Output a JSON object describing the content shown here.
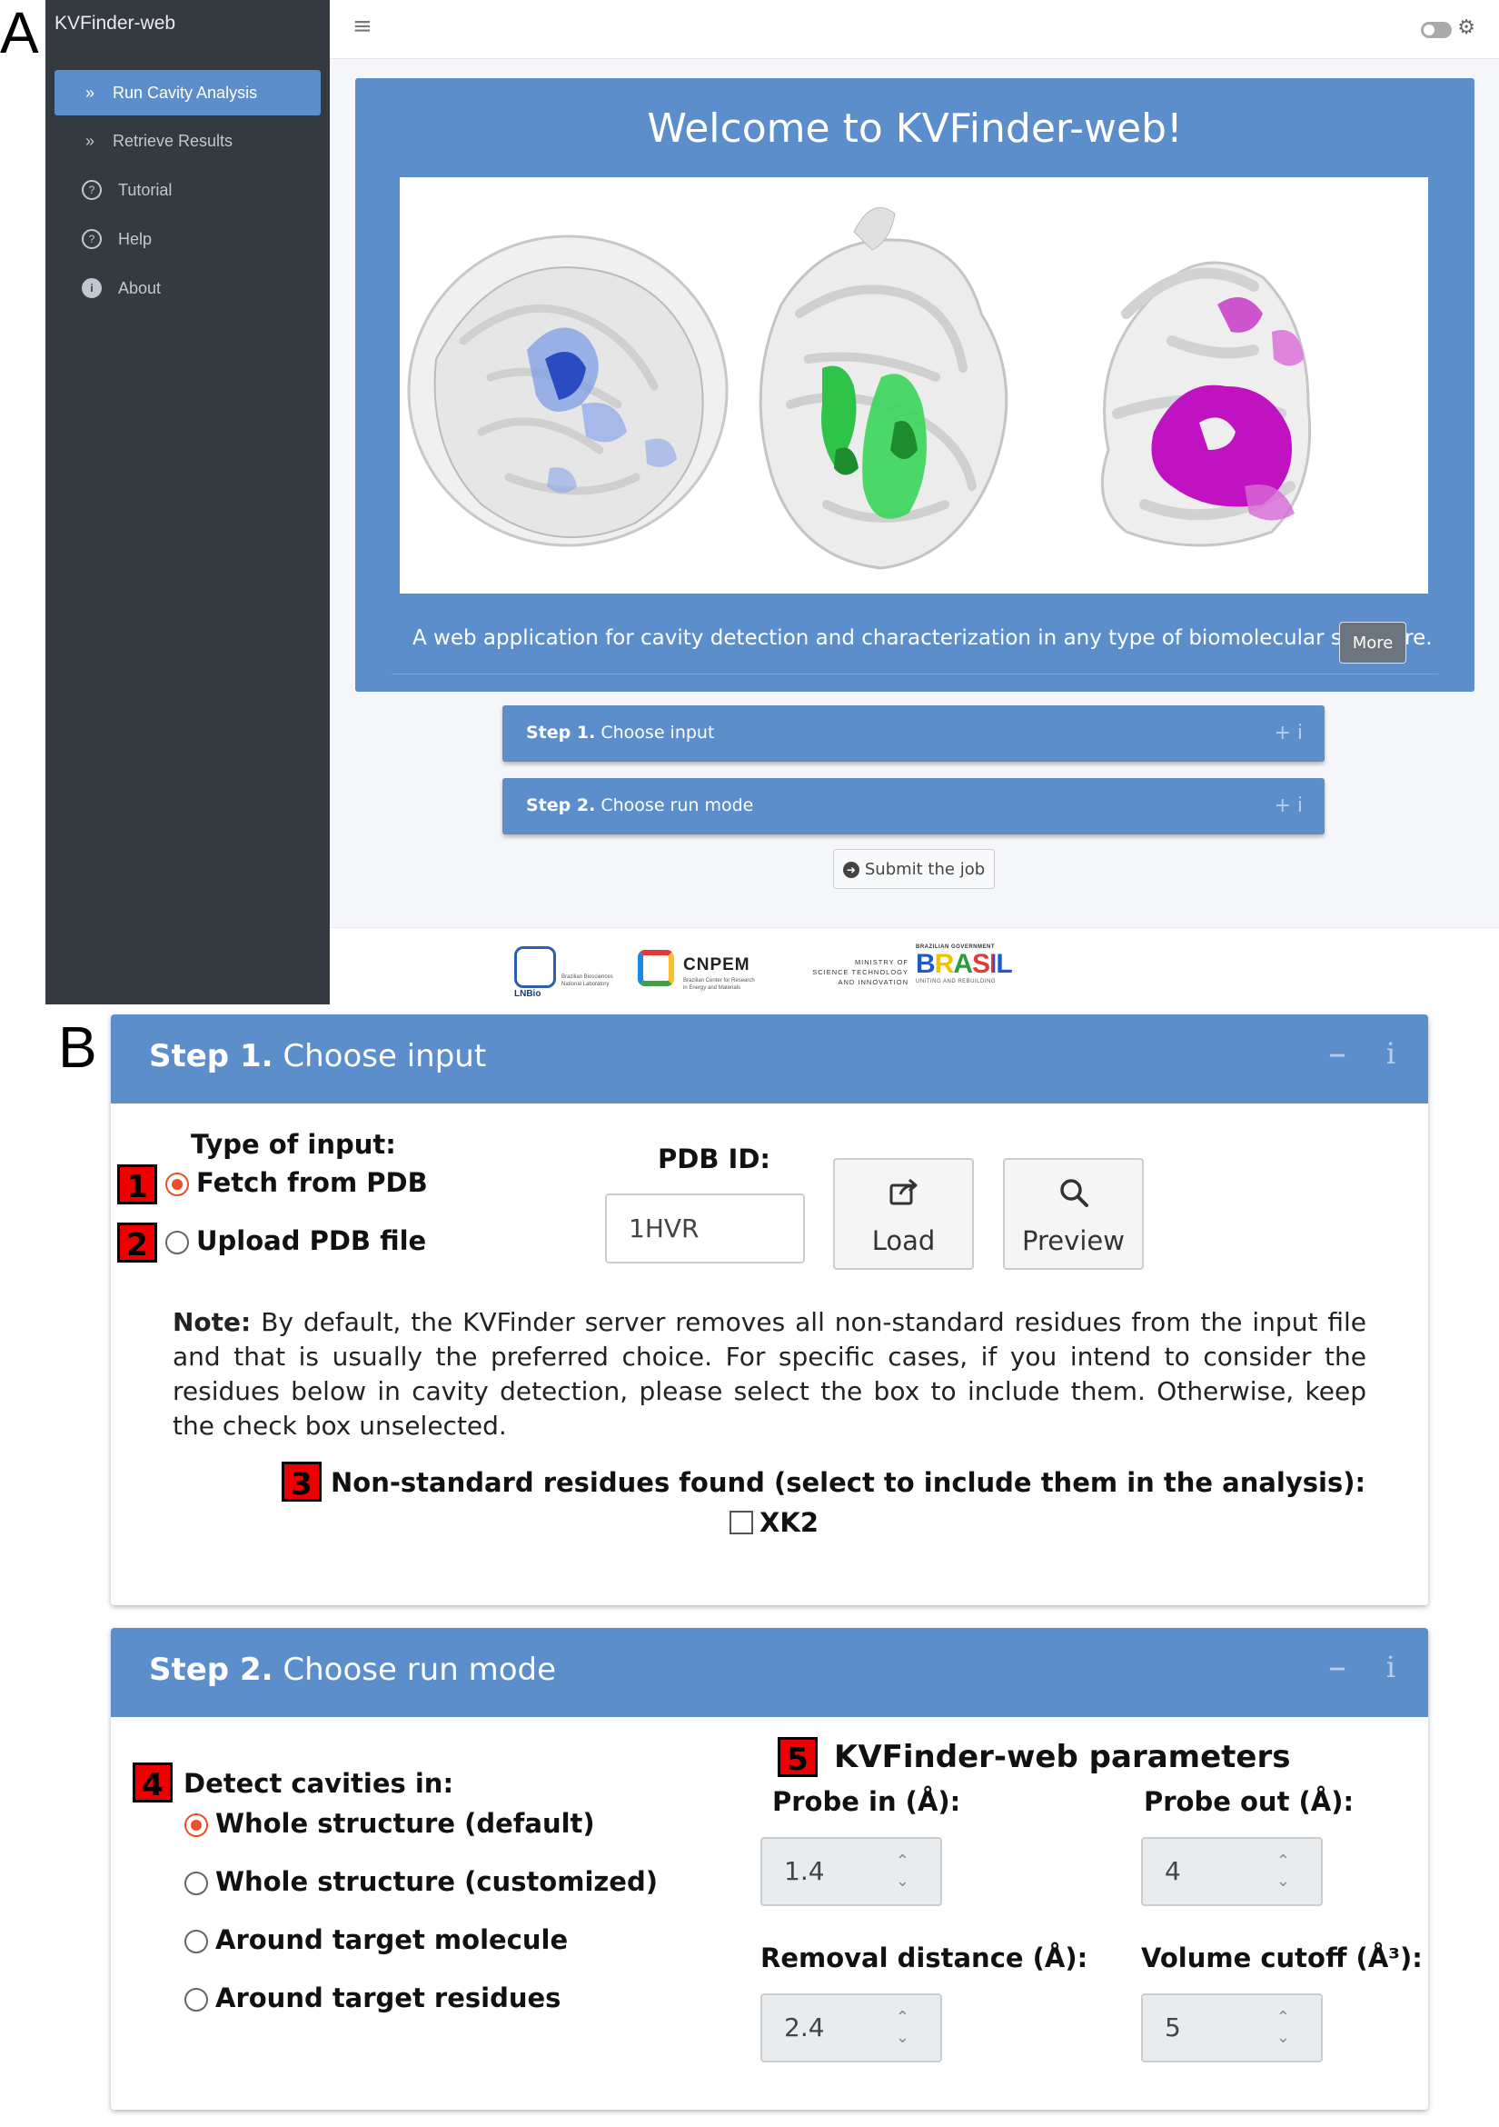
{
  "panel_labels": {
    "a": "A",
    "b": "B"
  },
  "app": {
    "brand": "KVFinder-web",
    "nav": [
      {
        "label": "Run Cavity Analysis",
        "icon": "double-chevron-right-icon",
        "active": true
      },
      {
        "label": "Retrieve Results",
        "icon": "double-chevron-right-icon",
        "active": false
      },
      {
        "label": "Tutorial",
        "icon": "question-circle-icon",
        "active": false
      },
      {
        "label": "Help",
        "icon": "question-circle-icon",
        "active": false
      },
      {
        "label": "About",
        "icon": "info-circle-icon",
        "active": false
      }
    ],
    "topbar": {
      "menu_icon": "hamburger-icon",
      "theme_toggle": "dark-mode-toggle",
      "settings_icon": "gear-icon"
    }
  },
  "hero": {
    "title": "Welcome to KVFinder-web!",
    "subtitle": "A web application for cavity detection and characterization in any type of biomolecular structure.",
    "more_button": "More",
    "cavity_colors": [
      "#3050c0",
      "#3cc83c",
      "#c012c0"
    ]
  },
  "steps_collapsed": [
    {
      "num": "Step 1.",
      "label": "Choose input",
      "tools": "+  i"
    },
    {
      "num": "Step 2.",
      "label": "Choose run mode",
      "tools": "+  i"
    }
  ],
  "submit_button": "Submit the job",
  "logos": {
    "lnbio": "LNBio",
    "lnbio_sub1": "Brazilian Biosciences",
    "lnbio_sub2": "National Laboratory",
    "cnpem": "CNPEM",
    "cnpem_sub1": "Brazilian Center for Research",
    "cnpem_sub2": "in Energy and Materials",
    "ministry_1": "MINISTRY OF",
    "ministry_2": "SCIENCE TECHNOLOGY",
    "ministry_3": "AND INNOVATION",
    "brasil_top": "BRAZILIAN GOVERNMENT",
    "brasil": "BRASIL",
    "brasil_bottom": "UNITING AND REBUILDING"
  },
  "step1": {
    "num": "Step 1.",
    "label": "Choose input",
    "minus": "–",
    "info": "i",
    "type_label": "Type of input:",
    "options": [
      {
        "marker": "1",
        "label": "Fetch from PDB",
        "selected": true
      },
      {
        "marker": "2",
        "label": "Upload PDB file",
        "selected": false
      }
    ],
    "pdb_label": "PDB ID:",
    "pdb_value": "1HVR",
    "load": "Load",
    "preview": "Preview",
    "note_bold": "Note:",
    "note_text": " By default, the KVFinder server removes all non-standard residues from the input file and that is usually the preferred choice. For specific cases, if you intend to consider the residues below in cavity detection, please select the box to include them. Otherwise, keep the check box unselected.",
    "nonstd_marker": "3",
    "nonstd_label": "Non-standard residues found (select to include them in the analysis):",
    "residue": "XK2",
    "residue_checked": false
  },
  "step2": {
    "num": "Step 2.",
    "label": "Choose run mode",
    "minus": "–",
    "info": "i",
    "detect_marker": "4",
    "detect_label": "Detect cavities in:",
    "options": [
      {
        "label": "Whole structure (default)",
        "selected": true
      },
      {
        "label": "Whole structure (customized)",
        "selected": false
      },
      {
        "label": "Around target molecule",
        "selected": false
      },
      {
        "label": "Around target residues",
        "selected": false
      }
    ],
    "params_marker": "5",
    "params_title": "KVFinder-web parameters",
    "params": [
      {
        "label": "Probe in (Å):",
        "value": "1.4"
      },
      {
        "label": "Probe out (Å):",
        "value": "4"
      },
      {
        "label": "Removal distance (Å):",
        "value": "2.4"
      },
      {
        "label": "Volume cutoff (Å³):",
        "value": "5"
      }
    ]
  }
}
